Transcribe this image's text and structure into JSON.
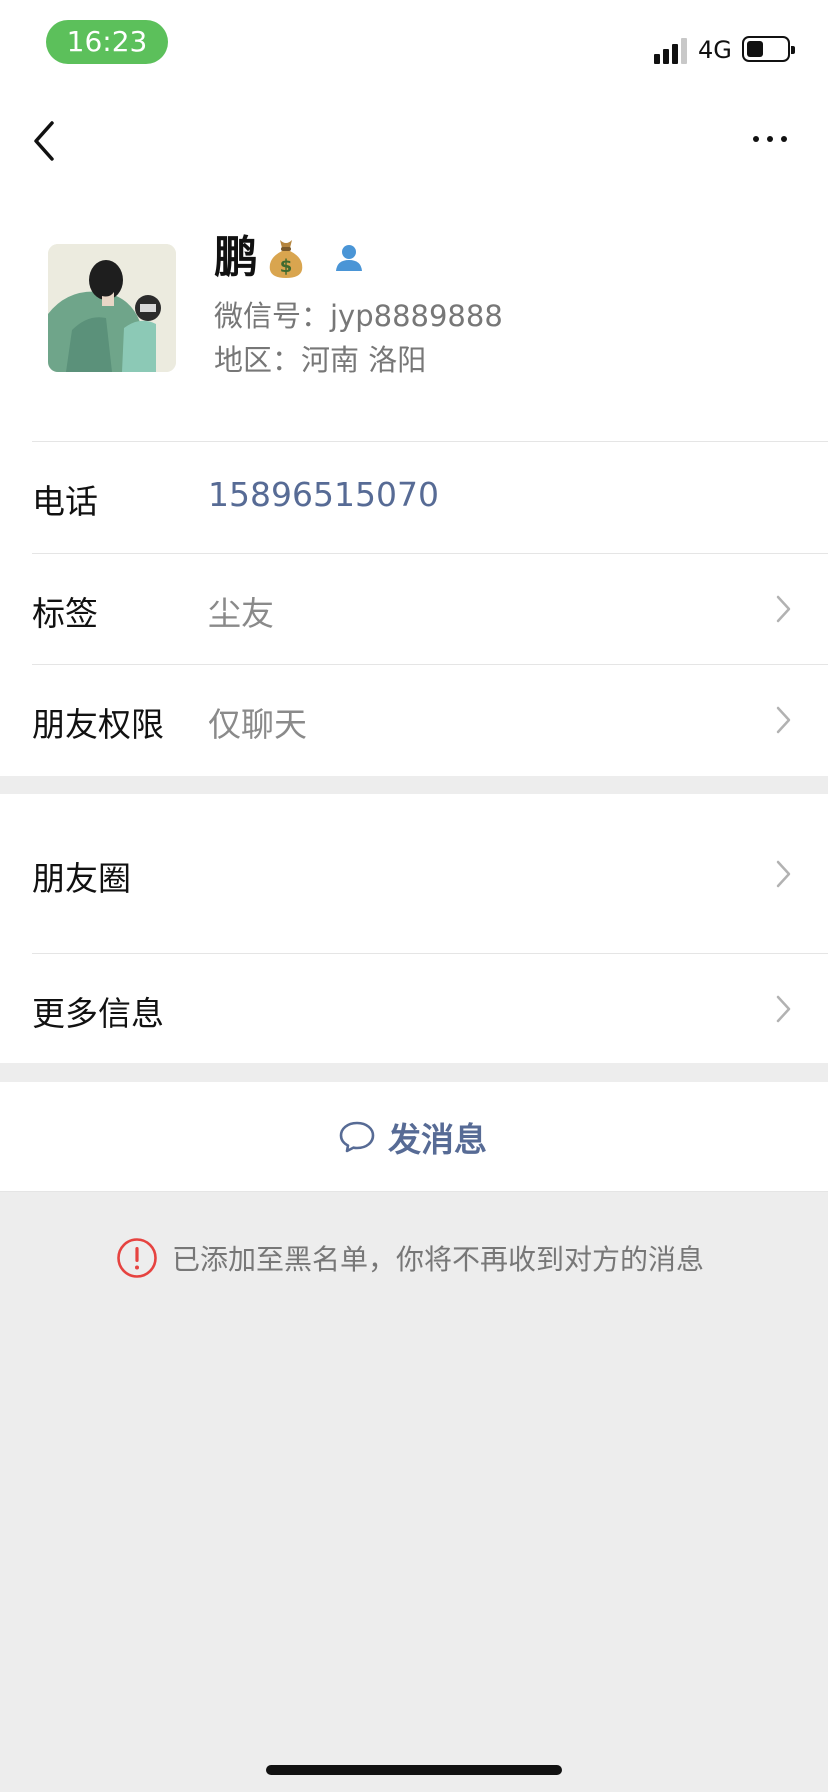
{
  "status_bar": {
    "time": "16:23",
    "network": "4G"
  },
  "nav": {
    "back_icon": "chevron-left-icon",
    "more_icon": "more-horizontal-icon"
  },
  "profile": {
    "name": "鹏",
    "name_emoji_icon": "money-bag-icon",
    "contact_icon": "contact-person-icon",
    "wechat_id": "微信号：jyp8889888",
    "region": "地区：河南 洛阳"
  },
  "rows": [
    {
      "label": "电话",
      "value": "15896515070"
    },
    {
      "label": "标签",
      "value": "尘友"
    },
    {
      "label": "朋友权限",
      "value": "仅聊天"
    },
    {
      "label": "朋友圈",
      "value": ""
    },
    {
      "label": "更多信息",
      "value": ""
    }
  ],
  "send": {
    "label": "发消息",
    "icon": "chat-bubble-icon"
  },
  "notice": {
    "icon": "warning-circle-icon",
    "text": "已添加至黑名单，你将不再收到对方的消息"
  },
  "colors": {
    "link": "#576b95",
    "status_pill": "#5cc05b",
    "warning": "#e64340",
    "background": "#ededed"
  }
}
